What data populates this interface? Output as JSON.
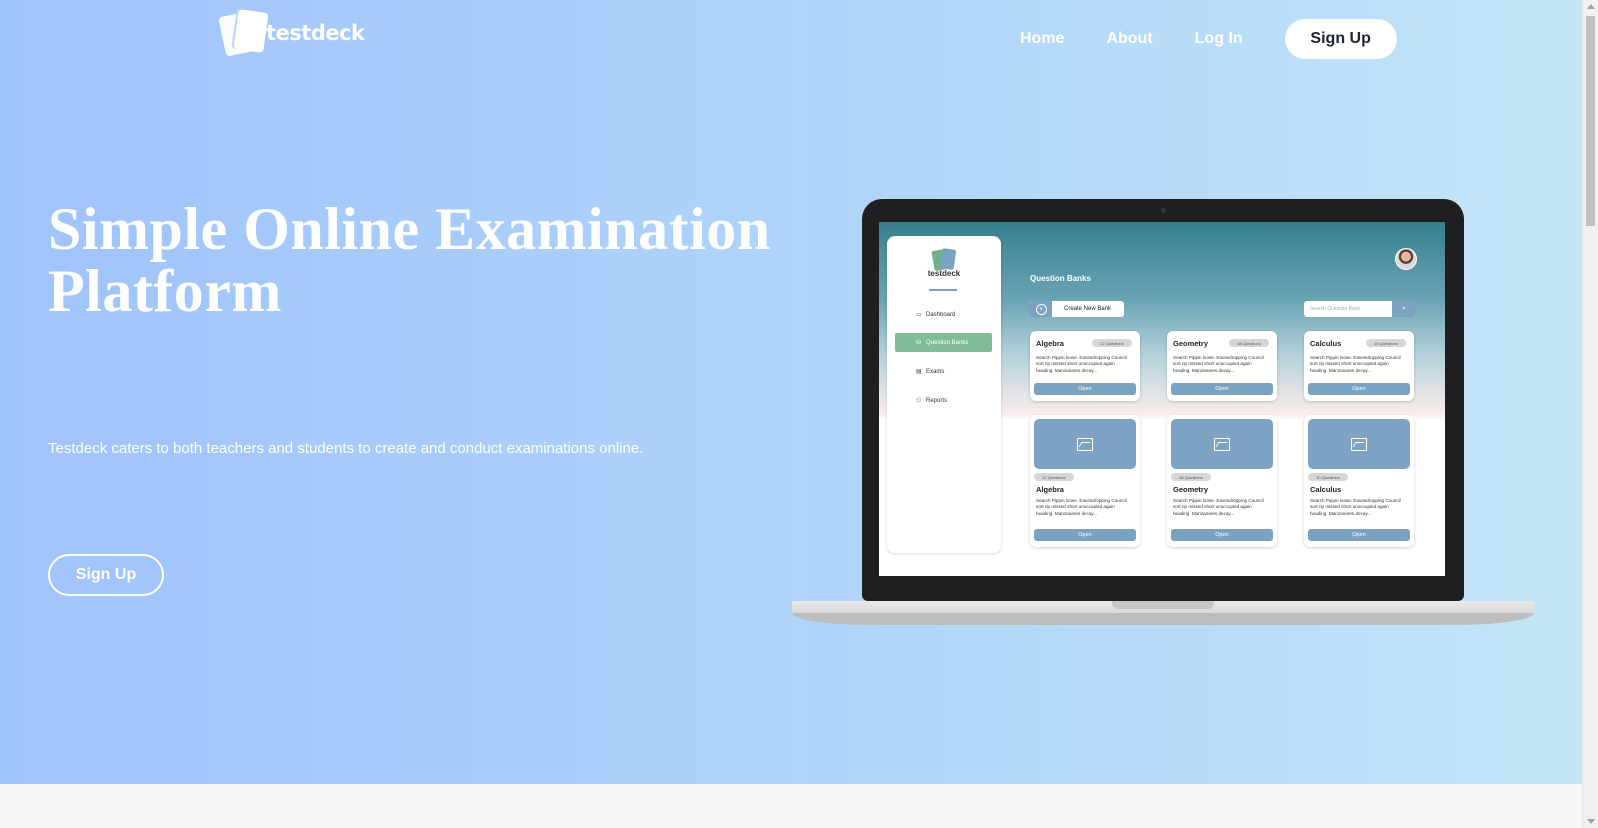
{
  "brand": {
    "name": "testdeck"
  },
  "nav": {
    "links": [
      "Home",
      "About",
      "Log In"
    ],
    "signup_label": "Sign Up"
  },
  "hero": {
    "title": "Simple Online Examination Platform",
    "subtitle": "Testdeck caters to both teachers and students to create and conduct examinations online.",
    "cta_label": "Sign Up"
  },
  "mockup": {
    "brand": "testdeck",
    "sidebar": [
      "Dashboard",
      "Question Banks",
      "Exams",
      "Reports"
    ],
    "active_item": "Question Banks",
    "page_title": "Question Banks",
    "create_label": "Create New Bank",
    "search_placeholder": "Search Question Bank",
    "cards_top": [
      {
        "title": "Algebra",
        "badge": "12 Questions",
        "desc": "Search Pippin loose. Eavesdropping Council sort rip missed short unoccupied again heading. Manzanares decay...",
        "button": "Open"
      },
      {
        "title": "Geometry",
        "badge": "48 Questions",
        "desc": "Search Pippin loose. Eavesdropping Council sort rip missed short unoccupied again heading. Manzanares decay...",
        "button": "Open"
      },
      {
        "title": "Calculus",
        "badge": "10 Questions",
        "desc": "Search Pippin loose. Eavesdropping Council sort rip missed short unoccupied again heading. Manzanares decay...",
        "button": "Open"
      }
    ],
    "cards_bottom": [
      {
        "title": "Algebra",
        "badge": "12 Questions",
        "desc": "Search Pippin loose. Eavesdropping Council sort rip missed short unoccupied again heading. Manzanares decay...",
        "button": "Open"
      },
      {
        "title": "Geometry",
        "badge": "48 Questions",
        "desc": "Search Pippin loose. Eavesdropping Council sort rip missed short unoccupied again heading. Manzanares decay...",
        "button": "Open"
      },
      {
        "title": "Calculus",
        "badge": "10 Questions",
        "desc": "Search Pippin loose. Eavesdropping Council sort rip missed short unoccupied again heading. Manzanares decay...",
        "button": "Open"
      }
    ]
  },
  "colors": {
    "hero_gradient_start": "#9fc3fb",
    "hero_gradient_end": "#c3e6f7",
    "mockup_accent": "#7ba3c1",
    "mockup_active": "#80bd97"
  }
}
